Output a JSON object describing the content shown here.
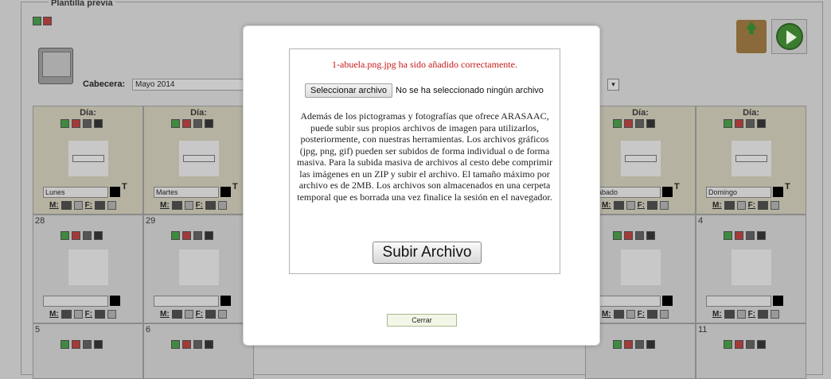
{
  "background": {
    "legend": "Plantilla previa",
    "cabecera_label": "Cabecera:",
    "cabecera_value": "Mayo 2014",
    "dia_label": "Día:",
    "tt_glyph": "T",
    "m_label": "M:",
    "f_label": "F:",
    "days": [
      {
        "day_label": "Día:",
        "name": "Lunes"
      },
      {
        "day_label": "Día:",
        "name": "Martes"
      },
      {
        "day_label": "Día:",
        "name": "ábado"
      },
      {
        "day_label": "Día:",
        "name": "Domingo"
      }
    ],
    "week_numbers": [
      "28",
      "29",
      "4",
      "5",
      "6",
      "11"
    ]
  },
  "modal": {
    "success_message": "1-abuela.png.jpg ha sido añadido correctamente.",
    "file_button_label": "Seleccionar archivo",
    "file_status": "No se ha seleccionado ningún archivo",
    "info_text": "Además de los pictogramas y fotografías que ofrece ARASAAC, puede subir sus propios archivos de imagen para utilizarlos, posteriormente, con nuestras herramientas. Los archivos gráficos (jpg, png, gif) pueden ser subidos de forma individual o de forma masiva. Para la subida masiva de archivos al cesto debe comprimir las imágenes en un ZIP y subir el archivo. El tamaño máximo por archivo es de 2MB. Los archivos son almacenados en una cerpeta temporal que es borrada una vez finalice la sesión en el navegador.",
    "upload_button_label": "Subir Archivo",
    "close_button_label": "Cerrar"
  },
  "colors": {
    "success": "#c81818",
    "overlay_bg": "#bdbdbd",
    "modal_bg": "#ffffff"
  }
}
